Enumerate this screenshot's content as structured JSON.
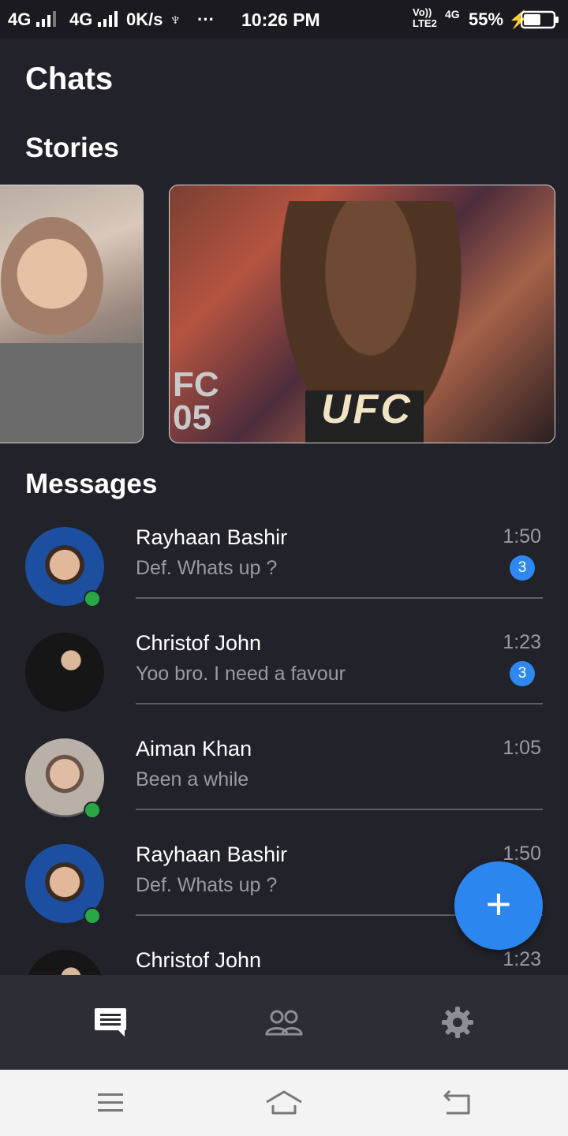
{
  "status_bar": {
    "signal_1": "4G",
    "signal_2": "4G",
    "speed": "0K/s",
    "usb_symbol": "♆",
    "more_symbol": "···",
    "time": "10:26 PM",
    "volte_top": "Vo))",
    "volte_bottom": "LTE2",
    "network": "4G",
    "battery_percent": "55%",
    "charging_symbol": "⚡"
  },
  "header": {
    "title": "Chats"
  },
  "stories": {
    "heading": "Stories",
    "items": [
      {
        "icon": "story-portrait-image"
      },
      {
        "icon": "story-ufc-image",
        "overlay_text": "UFC",
        "side_text": "FC\n05"
      }
    ]
  },
  "messages": {
    "heading": "Messages",
    "items": [
      {
        "name": "Rayhaan Bashir",
        "preview": "Def. Whats up ?",
        "time": "1:50",
        "unread": "3",
        "online": true,
        "avatar": "avatar-elon"
      },
      {
        "name": "Christof John",
        "preview": "Yoo bro. I need a favour",
        "time": "1:23",
        "unread": "3",
        "online": false,
        "avatar": "avatar-steve"
      },
      {
        "name": "Aiman Khan",
        "preview": "Been a while",
        "time": "1:05",
        "unread": "",
        "online": true,
        "avatar": "avatar-mark"
      },
      {
        "name": "Rayhaan Bashir",
        "preview": "Def. Whats up ?",
        "time": "1:50",
        "unread": "",
        "online": true,
        "avatar": "avatar-elon"
      },
      {
        "name": "Christof John",
        "preview": "",
        "time": "1:23",
        "unread": "",
        "online": false,
        "avatar": "avatar-steve"
      }
    ]
  },
  "fab": {
    "label": "+"
  },
  "bottom_nav": {
    "items": [
      "chats-icon",
      "contacts-icon",
      "settings-gear-icon"
    ]
  },
  "system_nav": {
    "items": [
      "menu-icon",
      "home-icon",
      "back-icon"
    ]
  },
  "colors": {
    "background": "#22222b",
    "accent": "#2b86ef",
    "online": "#28a745",
    "nav_bar": "#2d2d36"
  }
}
